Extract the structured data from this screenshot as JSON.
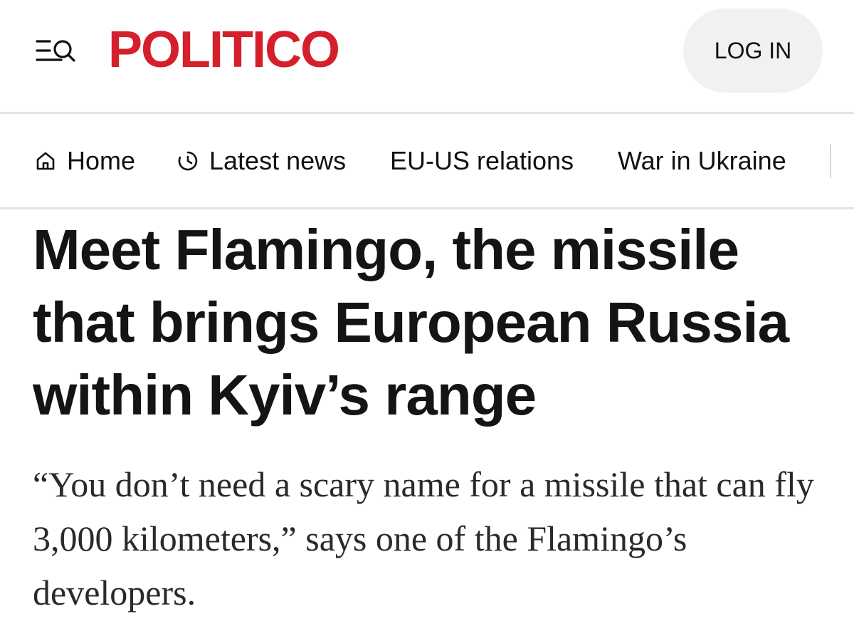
{
  "header": {
    "logo_text": "POLITICO",
    "login_label": "LOG IN",
    "menu_icon": "menu-search-icon"
  },
  "nav": {
    "items": [
      {
        "label": "Home",
        "icon": "home-icon"
      },
      {
        "label": "Latest news",
        "icon": "clock-icon"
      },
      {
        "label": "EU-US relations"
      },
      {
        "label": "War in Ukraine"
      }
    ]
  },
  "article": {
    "headline": "Meet Flamingo, the missile that brings European Russia within Kyiv’s range",
    "dek": "“You don’t need a scary name for a missile that can fly 3,000 kilometers,” says one of the Flamingo’s developers."
  },
  "colors": {
    "brand": "#d51f2b",
    "text": "#141414",
    "login_bg": "#f1f1f1",
    "divider": "#e4e4e4"
  }
}
